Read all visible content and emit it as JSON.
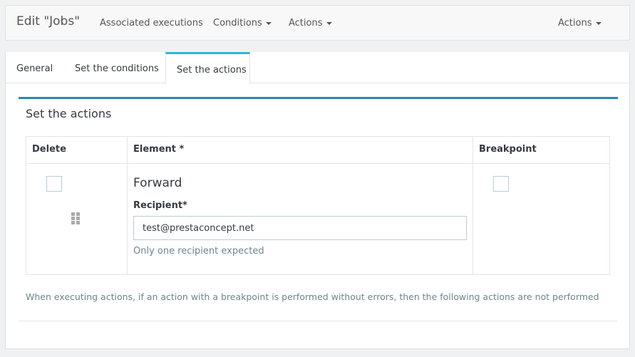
{
  "header": {
    "title": "Edit \"Jobs\"",
    "nav": {
      "associated": "Associated executions",
      "conditions": "Conditions",
      "actions": "Actions",
      "actions_right": "Actions"
    }
  },
  "tabs": {
    "general": "General",
    "conditions": "Set the conditions",
    "actions": "Set the actions"
  },
  "section": {
    "title": "Set the actions",
    "columns": {
      "delete": "Delete",
      "element": "Element *",
      "breakpoint": "Breakpoint"
    },
    "row": {
      "element_name": "Forward",
      "recipient_label": "Recipient*",
      "recipient_value": "test@prestaconcept.net",
      "recipient_help": "Only one recipient expected"
    },
    "note": "When executing actions, if an action with a breakpoint is performed without errors, then the following actions are not performed"
  }
}
